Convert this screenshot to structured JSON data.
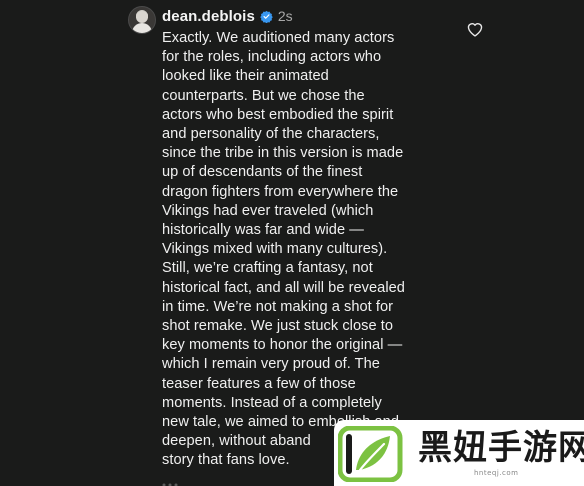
{
  "comment": {
    "author": {
      "username": "dean.deblois",
      "verified": true,
      "avatar_icon": "avatar-photo"
    },
    "timestamp": "2s",
    "like_icon": "heart-outline-icon",
    "text": "Exactly. We auditioned many actors\nfor the roles, including actors who\nlooked like their animated\ncounterparts. But we chose the\nactors who best embodied the spirit\nand personality of the characters,\nsince the tribe in this version is made\nup of descendants of the finest\ndragon fighters from everywhere the\nVikings had ever traveled (which\nhistorically was far and wide —\nVikings mixed with many cultures).\nStill, we’re crafting a fantasy, not\nhistorical fact, and all will be revealed\nin time. We’re not making a shot for\nshot remake. We just stuck close to\nkey moments to honor the original —\nwhich I remain very proud of. The\nteaser features a few of those\nmoments. Instead of a completely\nnew tale, we aimed to embellish and\ndeepen, without aband\nstory that fans love."
  },
  "watermark": {
    "text": "黑妞手游网",
    "url": "hnteqj.com"
  },
  "colors": {
    "background": "#1a1b1a",
    "text": "#f0f0f0",
    "muted": "#a8a8a8",
    "verified_blue": "#3897f0",
    "watermark_green": "#7cc242"
  }
}
